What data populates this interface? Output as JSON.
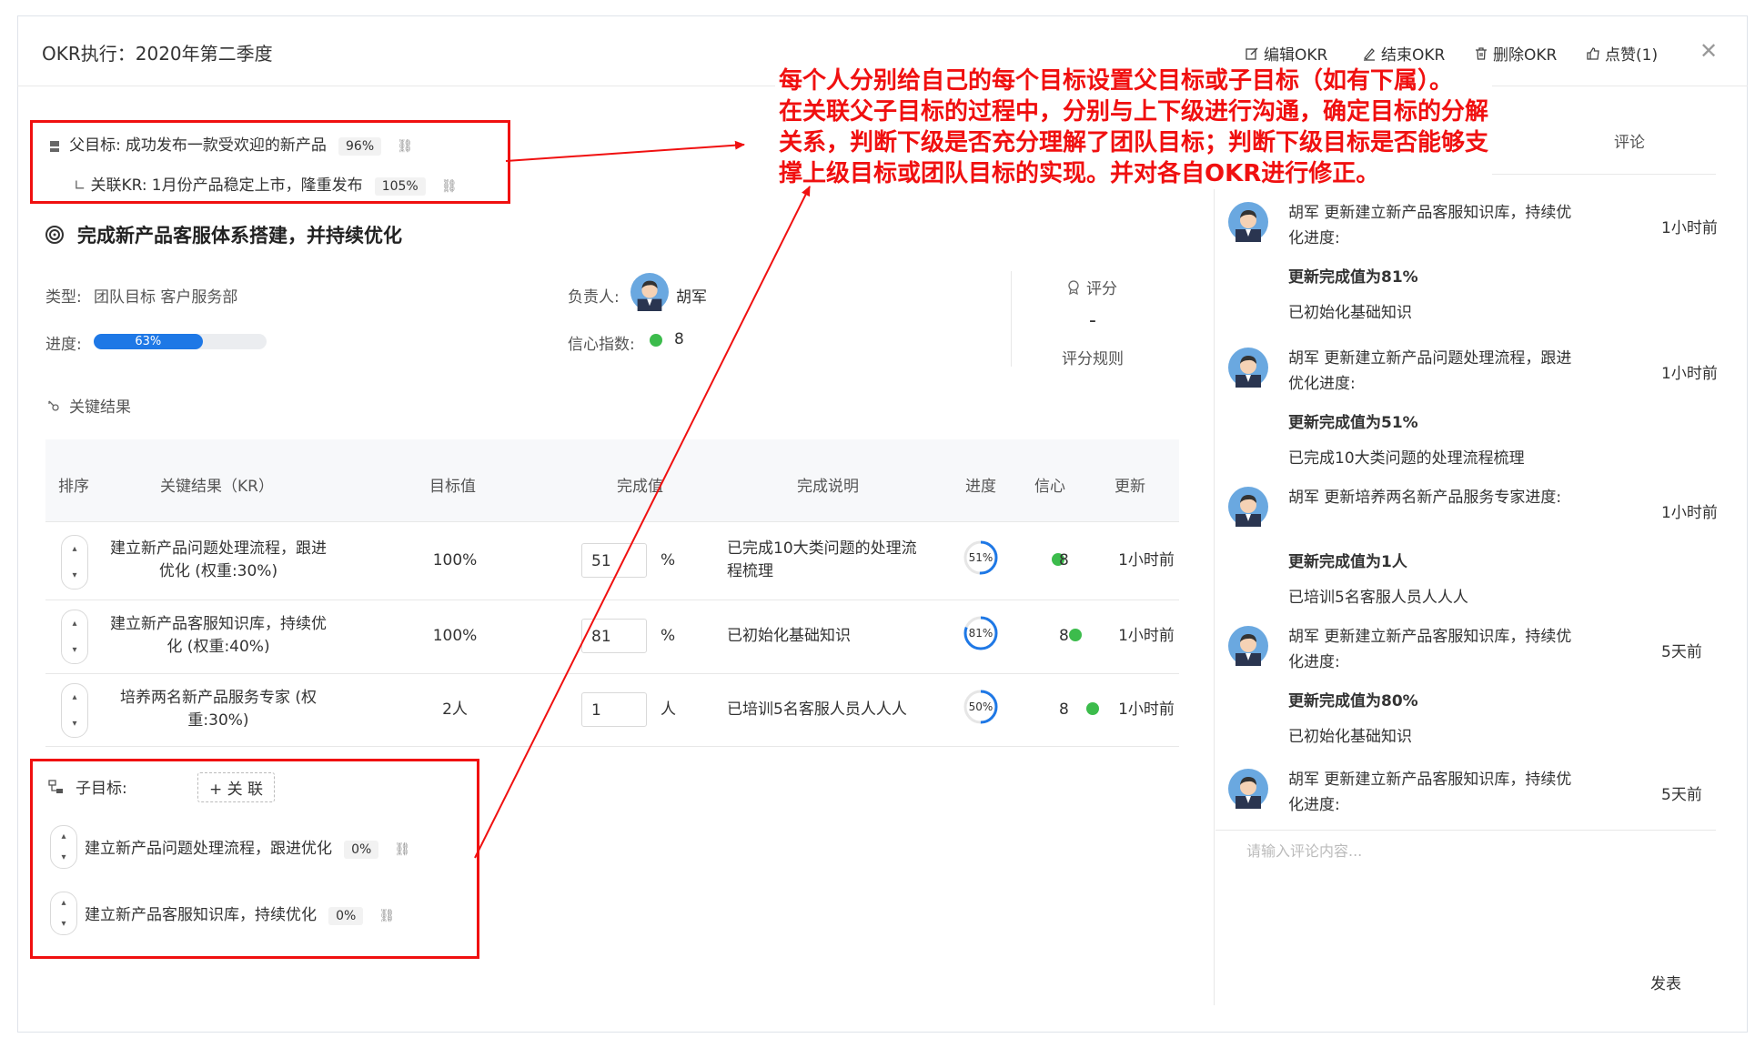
{
  "header": {
    "title": "OKR执行：2020年第二季度",
    "actions": {
      "edit": "编辑OKR",
      "end": "结束OKR",
      "delete": "删除OKR",
      "like": "点赞(1)"
    }
  },
  "parent": {
    "label": "父目标:",
    "name": "成功发布一款受欢迎的新产品",
    "percent": "96%",
    "kr_label": "关联KR:",
    "kr_name": "1月份产品稳定上市，隆重发布",
    "kr_percent": "105%"
  },
  "objective": {
    "title": "完成新产品客服体系搭建，并持续优化",
    "type_label": "类型:",
    "type_value": "团队目标 客户服务部",
    "owner_label": "负责人:",
    "owner_name": "胡军",
    "progress_label": "进度:",
    "progress": 63,
    "progress_text": "63%",
    "confidence_label": "信心指数:",
    "confidence_value": "8",
    "score_label": "评分",
    "score_value": "-",
    "score_rules": "评分规则"
  },
  "kr_section": {
    "title": "关键结果",
    "columns": [
      "排序",
      "关键结果（KR）",
      "目标值",
      "完成值",
      "完成说明",
      "进度",
      "信心",
      "更新"
    ],
    "rows": [
      {
        "kr": "建立新产品问题处理流程，跟进优化 (权重:30%)",
        "target": "100%",
        "value": "51",
        "unit": "%",
        "note": "已完成10大类问题的处理流程梳理",
        "progress": 51,
        "progress_text": "51%",
        "confidence": "8",
        "updated": "1小时前"
      },
      {
        "kr": "建立新产品客服知识库，持续优化 (权重:40%)",
        "target": "100%",
        "value": "81",
        "unit": "%",
        "note": "已初始化基础知识",
        "progress": 81,
        "progress_text": "81%",
        "confidence": "8",
        "updated": "1小时前"
      },
      {
        "kr": "培养两名新产品服务专家 (权重:30%)",
        "target": "2人",
        "value": "1",
        "unit": "人",
        "note": "已培训5名客服人员人人人",
        "progress": 50,
        "progress_text": "50%",
        "confidence": "8",
        "updated": "1小时前"
      }
    ]
  },
  "children": {
    "label": "子目标:",
    "link_button": "+ 关 联",
    "items": [
      {
        "name": "建立新产品问题处理流程，跟进优化",
        "percent": "0%"
      },
      {
        "name": "建立新产品客服知识库，持续优化",
        "percent": "0%"
      }
    ]
  },
  "annotation": {
    "lines": [
      "每个人分别给自己的每个目标设置父目标或子目标（如有下属）。",
      "在关联父子目标的过程中，分别与上下级进行沟通，确定目标的分解",
      "关系，判断下级是否充分理解了团队目标；判断下级目标是否能够支",
      "撑上级目标或团队目标的实现。并对各自OKR进行修正。"
    ]
  },
  "comments": {
    "tab": "评论",
    "feed": [
      {
        "title1": "胡军 更新建立新产品客服知识库，持续优",
        "title2": "化进度:",
        "time": "1小时前",
        "bold": "更新完成值为81%",
        "note": "已初始化基础知识"
      },
      {
        "title1": "胡军 更新建立新产品问题处理流程，跟进",
        "title2": "优化进度:",
        "time": "1小时前",
        "bold": "更新完成值为51%",
        "note": "已完成10大类问题的处理流程梳理"
      },
      {
        "title1": "胡军 更新培养两名新产品服务专家进度:",
        "title2": "",
        "time": "1小时前",
        "bold": "更新完成值为1人",
        "note": "已培训5名客服人员人人人"
      },
      {
        "title1": "胡军 更新建立新产品客服知识库，持续优",
        "title2": "化进度:",
        "time": "5天前",
        "bold": "更新完成值为80%",
        "note": "已初始化基础知识"
      },
      {
        "title1": "胡军 更新建立新产品客服知识库，持续优",
        "title2": "化进度:",
        "time": "5天前",
        "bold": "",
        "note": ""
      }
    ],
    "placeholder": "请输入评论内容...",
    "send": "发表"
  },
  "colors": {
    "accent": "#1e78e6",
    "annotation": "#f01010",
    "confidence": "#3cbc4c"
  }
}
